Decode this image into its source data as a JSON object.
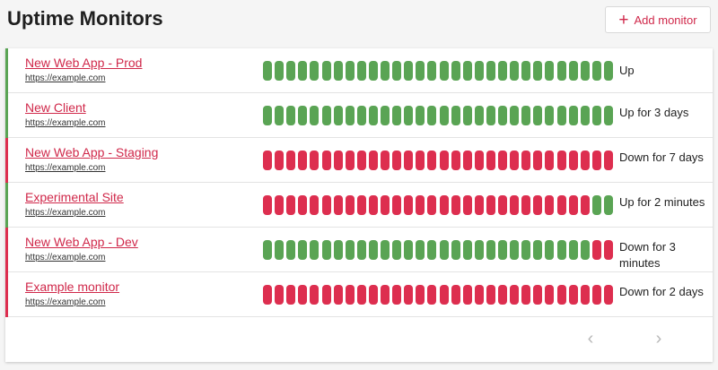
{
  "header": {
    "title": "Uptime Monitors",
    "add_button_label": "Add monitor",
    "add_icon": "plus-icon"
  },
  "colors": {
    "up": "#5aa454",
    "down": "#dd2e4f",
    "accent": "#d0284a"
  },
  "monitors": [
    {
      "name": "New Web App - Prod",
      "url": "https://example.com",
      "state": "up",
      "status": "Up",
      "beats": "uuuuuuuuuuuuuuuuuuuuuuuuuuuuuuuuuuuuuuuu"
    },
    {
      "name": "New Client",
      "url": "https://example.com",
      "state": "up",
      "status": "Up for 3 days",
      "beats": "uuuuuuuuuuuuuuuuuuuuuuuuuuuuuuuuuuuuuuuu"
    },
    {
      "name": "New Web App - Staging",
      "url": "https://example.com",
      "state": "down",
      "status": "Down for 7 days",
      "beats": "dddddddddddddddddddddddddddddddddddddddd"
    },
    {
      "name": "Experimental Site",
      "url": "https://example.com",
      "state": "up",
      "status": "Up for 2 minutes",
      "beats": "ddddddddddddddddddddddddddddddddddddddduu"
    },
    {
      "name": "New Web App - Dev",
      "url": "https://example.com",
      "state": "down",
      "status": "Down for 3 minutes",
      "beats": "uuuuuuuuuuuuuuuuuuuuuuuuuuuuuuuuuuuuuuudd"
    },
    {
      "name": "Example monitor",
      "url": "https://example.com",
      "state": "down",
      "status": "Down for 2 days",
      "beats": "dddddddddddddddddddddddddddddddddddddddd"
    }
  ],
  "pagination": {
    "prev_icon": "chevron-left-icon",
    "next_icon": "chevron-right-icon"
  }
}
